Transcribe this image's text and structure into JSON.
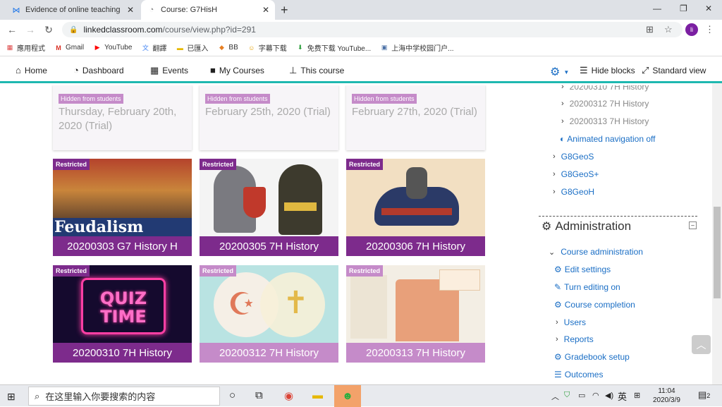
{
  "browser": {
    "tabs": [
      {
        "title": "Evidence of online teaching - [",
        "icon": "mail-icon"
      },
      {
        "title": "Course: G7HisH",
        "icon": "moodle-icon"
      }
    ],
    "url_domain": "linkedclassroom.com",
    "url_path": "/course/view.php?id=291",
    "avatar": "li",
    "bookmarks": [
      "應用程式",
      "Gmail",
      "YouTube",
      "翻譯",
      "已匯入",
      "BB",
      "字幕下载",
      "免费下载 YouTube...",
      "上海中学校园门户..."
    ]
  },
  "nav": {
    "home": "Home",
    "dashboard": "Dashboard",
    "events": "Events",
    "mycourses": "My Courses",
    "thiscourse": "This course",
    "hideblocks": "Hide blocks",
    "standardview": "Standard view"
  },
  "hidden_cards": [
    {
      "badge": "Hidden from students",
      "date": "Thursday, February 20th, 2020 (Trial)"
    },
    {
      "badge": "Hidden from students",
      "date": "February 25th, 2020 (Trial)"
    },
    {
      "badge": "Hidden from students",
      "date": "February 27th, 2020 (Trial)"
    }
  ],
  "courses": [
    {
      "badge": "Restricted",
      "title": "20200303 G7 History H",
      "image_text": "Feudalism"
    },
    {
      "badge": "Restricted",
      "title": "20200305 7H History"
    },
    {
      "badge": "Restricted",
      "title": "20200306 7H History"
    },
    {
      "badge": "Restricted",
      "title": "20200310 7H History",
      "image_text": "QUIZ TIME"
    },
    {
      "badge": "Restricted",
      "title": "20200312 7H History"
    },
    {
      "badge": "Restricted",
      "title": "20200313 7H History"
    }
  ],
  "sidebar": {
    "nav_items": [
      "20200310 7H History",
      "20200312 7H History",
      "20200313 7H History"
    ],
    "animated": "Animated navigation off",
    "courses": [
      "G8GeoS",
      "G8GeoS+",
      "G8GeoH"
    ],
    "admin_title": "Administration",
    "course_admin": "Course administration",
    "admin_items": [
      "Edit settings",
      "Turn editing on",
      "Course completion",
      "Users",
      "Reports",
      "Gradebook setup",
      "Outcomes"
    ]
  },
  "taskbar": {
    "search_placeholder": "在这里输入你要搜索的内容",
    "ime": "英",
    "time": "11:04",
    "date": "2020/3/9",
    "notifications": "2"
  },
  "colors": {
    "accent": "#1fb8b0",
    "purple": "#7d2b8c",
    "light_purple": "#c58bc9",
    "link": "#1a6ec5"
  }
}
